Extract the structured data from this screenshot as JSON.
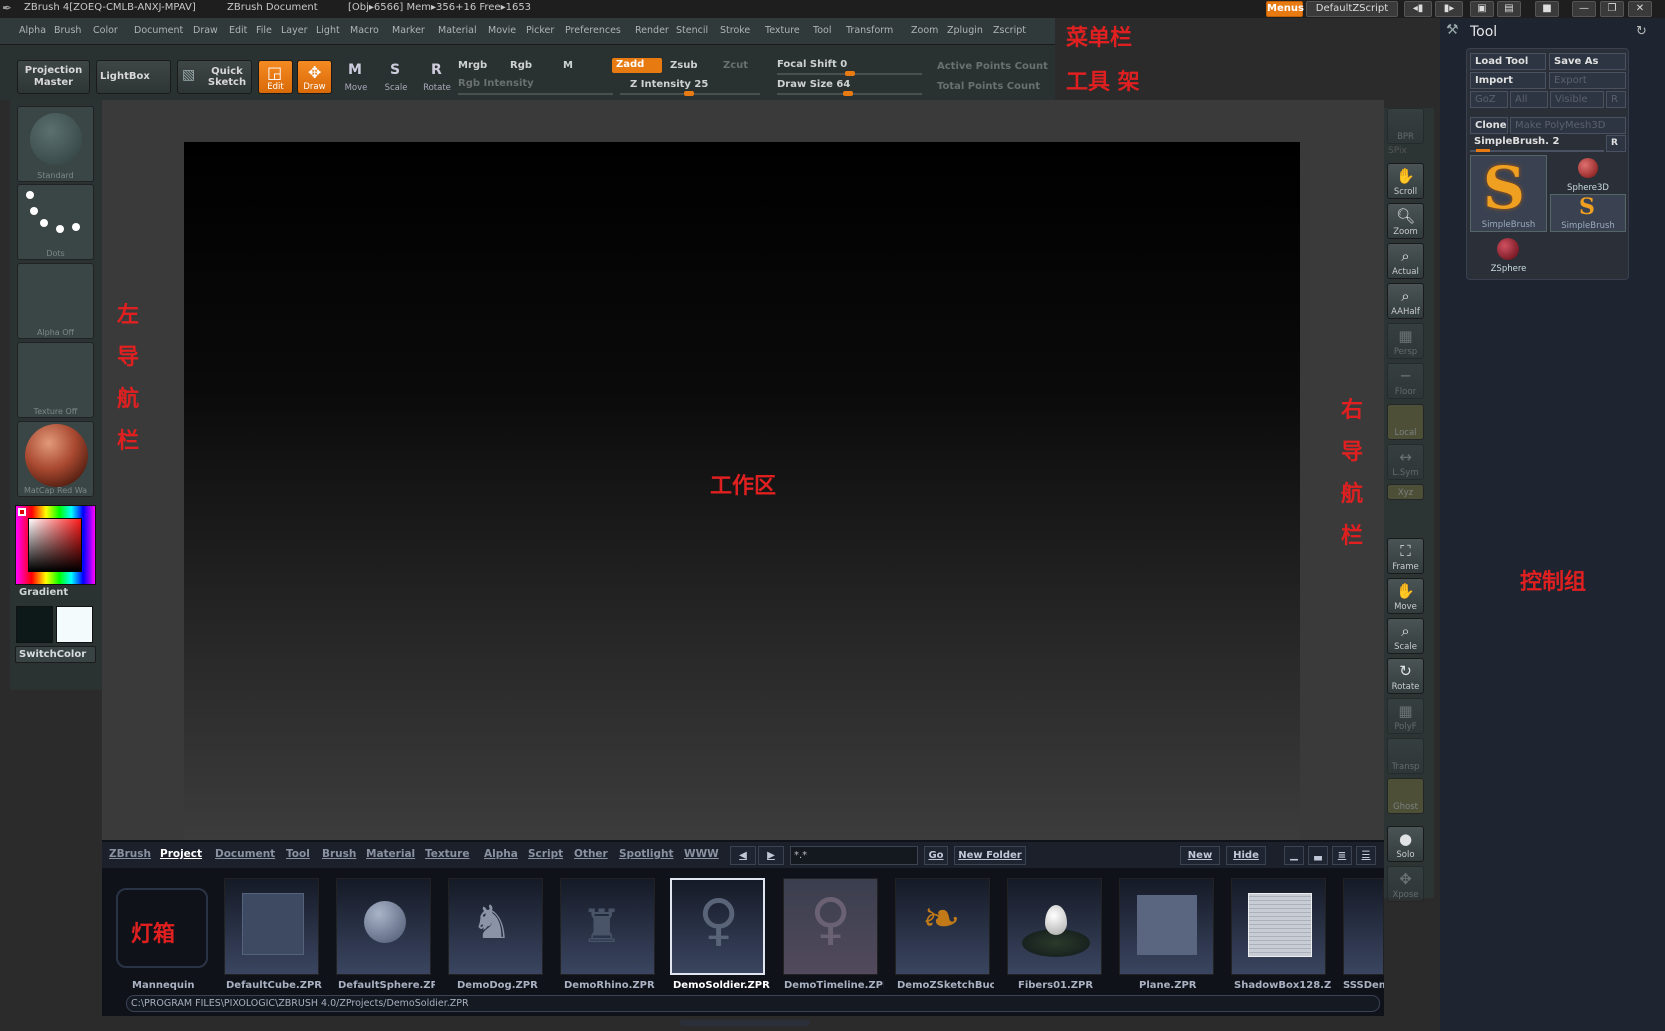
{
  "titlebar": {
    "app": "ZBrush 4[ZOEQ-CMLB-ANXJ-MPAV]",
    "doc": "ZBrush Document",
    "stats": "[Obj▸6566] Mem▸356+16 Free▸1653",
    "menus_btn": "Menus",
    "script_btn": "DefaultZScript"
  },
  "menubar": {
    "items": [
      "Alpha",
      "Brush",
      "Color",
      "Document",
      "Draw",
      "Edit",
      "File",
      "Layer",
      "Light",
      "Macro",
      "Marker",
      "Material",
      "Movie",
      "Picker",
      "Preferences",
      "Render",
      "Stencil",
      "Stroke",
      "Texture",
      "Tool",
      "Transform",
      "Zoom",
      "Zplugin",
      "Zscript"
    ]
  },
  "shelf": {
    "projection_master": "Projection Master",
    "lightbox": "LightBox",
    "quick_sketch": "Quick Sketch",
    "edit": "Edit",
    "draw": "Draw",
    "move": "Move",
    "scale": "Scale",
    "rotate": "Rotate",
    "mrgb": "Mrgb",
    "rgb": "Rgb",
    "m": "M",
    "rgb_intensity": "Rgb Intensity",
    "zadd": "Zadd",
    "zsub": "Zsub",
    "zcut": "Zcut",
    "z_intensity": "Z Intensity 25",
    "focal_shift": "Focal Shift 0",
    "draw_size": "Draw Size 64",
    "active_points": "Active Points Count",
    "total_points": "Total Points Count"
  },
  "leftnav": {
    "brush": "Standard",
    "stroke": "Dots",
    "alpha": "Alpha Off",
    "texture": "Texture Off",
    "material": "MatCap Red Wa",
    "gradient": "Gradient",
    "switchcolor": "SwitchColor"
  },
  "rightnav": {
    "items": [
      "BPR",
      "SPix",
      "Scroll",
      "Zoom",
      "Actual",
      "AAHalf",
      "Persp",
      "Floor",
      "Local",
      "L.Sym",
      "Xyz",
      "Frame",
      "Move",
      "Scale",
      "Rotate",
      "PolyF",
      "Transp",
      "Ghost",
      "Solo",
      "Xpose"
    ]
  },
  "tool_panel": {
    "title": "Tool",
    "load_tool": "Load Tool",
    "save_as": "Save As",
    "import": "Import",
    "export": "Export",
    "goz": "GoZ",
    "all": "All",
    "visible": "Visible",
    "r": "R",
    "clone": "Clone",
    "make_polymesh": "Make PolyMesh3D",
    "current_tool": "SimpleBrush. 2",
    "tools": [
      "SimpleBrush",
      "Sphere3D",
      "SimpleBrush",
      "ZSphere"
    ]
  },
  "lightbox": {
    "tabs": [
      "ZBrush",
      "Project",
      "Document",
      "Tool",
      "Brush",
      "Material",
      "Texture",
      "Alpha",
      "Script",
      "Other",
      "Spotlight",
      "WWW"
    ],
    "active_tab": "Project",
    "filter": "*.*",
    "go": "Go",
    "new_folder": "New Folder",
    "new": "New",
    "hide": "Hide",
    "items": [
      "Mannequin",
      "DefaultCube.ZPR",
      "DefaultSphere.ZPR",
      "DemoDog.ZPR",
      "DemoRhino.ZPR",
      "DemoSoldier.ZPR",
      "DemoTimeline.ZPR",
      "DemoZSketchBuc",
      "Fibers01.ZPR",
      "Plane.ZPR",
      "ShadowBox128.ZPR",
      "SSSDem"
    ],
    "selected": "DemoSoldier.ZPR",
    "path": "C:\\PROGRAM FILES\\PIXOLOGIC\\ZBRUSH 4.0/ZProjects/DemoSoldier.ZPR"
  },
  "annotations": {
    "menubar": "菜单栏",
    "shelf": "工具 架",
    "left": [
      "左",
      "导",
      "航",
      "栏"
    ],
    "workspace": "工作区",
    "right": [
      "右",
      "导",
      "航",
      "栏"
    ],
    "control": "控制组",
    "lightbox": "灯箱"
  },
  "colors": {
    "accent": "#e87a12",
    "annotation": "#e02020"
  }
}
